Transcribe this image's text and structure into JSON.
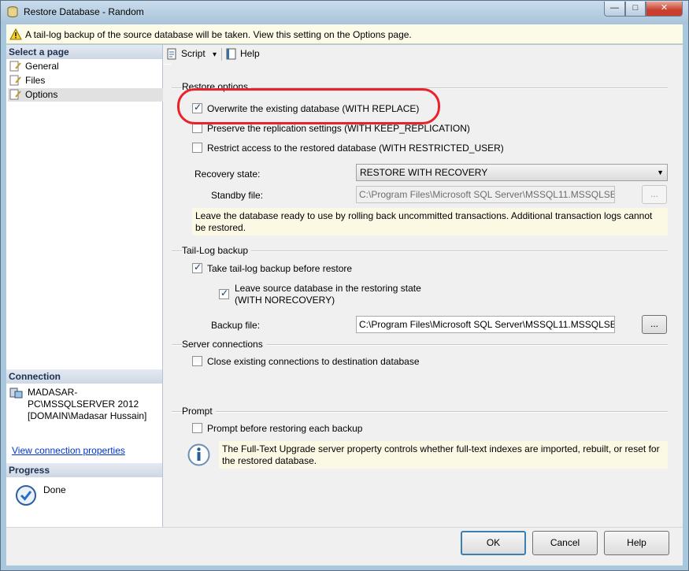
{
  "window": {
    "title": "Restore Database - Random",
    "min_glyph": "—",
    "max_glyph": "□",
    "close_glyph": "✕"
  },
  "infobar": {
    "text": "A tail-log backup of the source database will be taken. View this setting on the Options page."
  },
  "left": {
    "select_page_header": "Select a page",
    "pages": [
      "General",
      "Files",
      "Options"
    ],
    "selected_page": "Options",
    "connection_header": "Connection",
    "connection_text": "MADASAR-PC\\MSSQLSERVER 2012 [DOMAIN\\Madasar Hussain]",
    "connection_link": "View connection properties",
    "progress_header": "Progress",
    "progress_status": "Done"
  },
  "toolbar": {
    "script_label": "Script",
    "script_arrow": "▾",
    "help_label": "Help"
  },
  "restore_options": {
    "header": "Restore options",
    "overwrite_label": "Overwrite the existing database (WITH REPLACE)",
    "overwrite_checked": true,
    "preserve_label": "Preserve the replication settings (WITH KEEP_REPLICATION)",
    "preserve_checked": false,
    "restrict_label": "Restrict access to the restored database (WITH RESTRICTED_USER)",
    "restrict_checked": false,
    "recovery_label": "Recovery state:",
    "recovery_value": "RESTORE WITH RECOVERY",
    "recovery_arrow": "▼",
    "standby_label": "Standby file:",
    "standby_value": "C:\\Program Files\\Microsoft SQL Server\\MSSQL11.MSSQLSERVER\\MSSQL\\Backup\\Random_RollbackUndo.bak",
    "browse_label": "...",
    "description": "Leave the database ready to use by rolling back uncommitted transactions. Additional transaction logs cannot be restored."
  },
  "tail_log": {
    "header": "Tail-Log backup",
    "take_label": "Take tail-log backup before restore",
    "take_checked": true,
    "leave_label_1": "Leave source database in the restoring state",
    "leave_label_2": "(WITH NORECOVERY)",
    "leave_checked": true,
    "backup_file_label": "Backup file:",
    "backup_file_value": "C:\\Program Files\\Microsoft SQL Server\\MSSQL11.MSSQLSERVER\\MSSQL\\Backup\\Random_LogBackup.bak",
    "browse_label": "..."
  },
  "server_connections": {
    "header": "Server connections",
    "close_label": "Close existing connections to destination database",
    "close_checked": false
  },
  "prompt": {
    "header": "Prompt",
    "prompt_label": "Prompt before restoring each backup",
    "prompt_checked": false,
    "info_text": "The Full-Text Upgrade server property controls whether full-text indexes are imported, rebuilt, or reset for the restored database."
  },
  "buttons": {
    "ok": "OK",
    "cancel": "Cancel",
    "help": "Help"
  }
}
